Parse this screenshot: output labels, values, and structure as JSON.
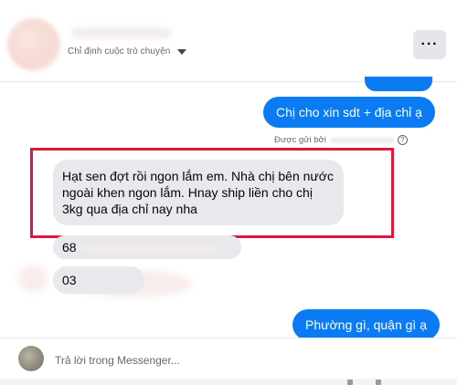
{
  "header": {
    "name_tail": "...",
    "subtitle": "Chỉ định cuộc trò chuyện",
    "more_label": "···"
  },
  "messages": {
    "outgoing_1": "Chị cho xin sdt + địa chỉ ạ",
    "sent_by_label": "Được gửi bởi",
    "incoming_1": "Hạt sen đợt rồi ngon lắm em. Nhà chị bên nước ngoài khen ngon lắm. Hnay ship liền cho chị 3kg qua địa chỉ nay nha",
    "incoming_2_prefix": "68",
    "incoming_3_prefix": "03",
    "outgoing_2": "Phường gì, quận gì ạ"
  },
  "composer": {
    "placeholder": "Trả lời trong Messenger..."
  },
  "colors": {
    "outgoing_bubble": "#0b7bf4",
    "incoming_bubble": "#e8e9ed",
    "highlight_box": "#e0163a"
  }
}
